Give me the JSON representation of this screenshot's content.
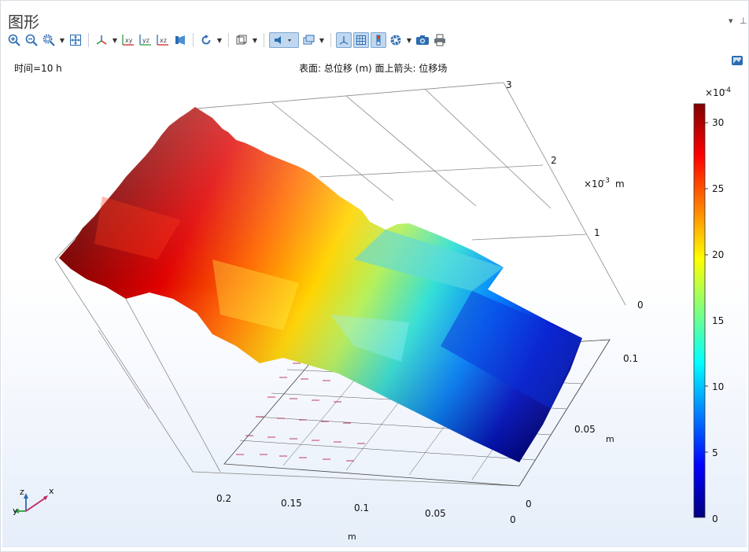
{
  "window": {
    "title": "图形",
    "dropdown_glyph": "▾",
    "pin_glyph": "⊥"
  },
  "toolbar": {
    "buttons": [
      "zoom-in-icon",
      "zoom-out-icon",
      "zoom-box-icon",
      "zoom-extents-icon",
      "axis-orientation-icon",
      "view-xy-icon",
      "view-yz-icon",
      "view-xz-icon",
      "camera-view-icon",
      "rotate-icon",
      "scene-light-icon",
      "transparency-icon",
      "wireframe-icon",
      "axis-toggle-icon",
      "grid-toggle-icon",
      "legend-toggle-icon",
      "color-icon",
      "snapshot-icon",
      "print-icon"
    ],
    "label_xy": "xy",
    "label_yz": "yz",
    "label_xz": "xz"
  },
  "plot": {
    "time_label": "时间=10 h",
    "description": "表面: 总位移 (m)  面上箭头: 位移场"
  },
  "colorbar": {
    "exponent_base": "×10",
    "exponent_power": "-4",
    "ticks": [
      "30",
      "25",
      "20",
      "15",
      "10",
      "5",
      "0"
    ],
    "min": 0,
    "max": 31,
    "colors": [
      "#00007f",
      "#0000ff",
      "#007fff",
      "#00ffff",
      "#7fff7f",
      "#ffff00",
      "#ff7f00",
      "#ff0000",
      "#7f0000"
    ]
  },
  "axes": {
    "z_ticks": [
      "3",
      "2",
      "1",
      "0"
    ],
    "z_unit_base": "×10",
    "z_unit_power": "-3",
    "z_unit": "m",
    "y_ticks": [
      "0.1",
      "0.05",
      "0"
    ],
    "y_label": "m",
    "x_ticks": [
      "0.2",
      "0.15",
      "0.1",
      "0.05",
      "0"
    ],
    "x_label": "m"
  },
  "triad": {
    "x": "x",
    "y": "y",
    "z": "z"
  }
}
